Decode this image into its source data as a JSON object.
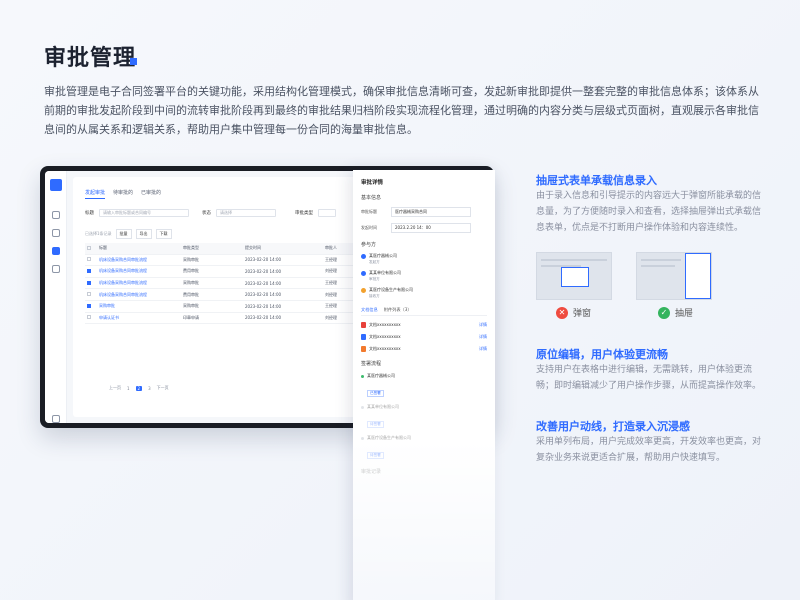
{
  "header": {
    "title": "审批管理",
    "description": "审批管理是电子合同签署平台的关键功能，采用结构化管理模式，确保审批信息清晰可查，发起新审批即提供一整套完整的审批信息体系；该体系从前期的审批发起阶段到中间的流转审批阶段再到最终的审批结果归档阶段实现流程化管理，通过明确的内容分类与层级式页面树，直观展示各审批信息间的从属关系和逻辑关系，帮助用户集中管理每一份合同的海量审批信息。"
  },
  "mockup": {
    "tabs": [
      "发起审批",
      "待审批的",
      "已审批的"
    ],
    "filter": {
      "label1": "标题",
      "placeholder1": "请输入审批标题或合同编号",
      "label2": "状态",
      "placeholder2": "请选择",
      "label3": "审批类型"
    },
    "toolbar": {
      "label": "已选择1条记录",
      "btn1": "批量",
      "btn2": "导出",
      "btn3": "下载"
    },
    "table": {
      "headers": [
        "标题",
        "审批类型",
        "提交时间",
        "审批人"
      ],
      "rows": [
        {
          "checked": false,
          "title": "机床设备采购合同审批流程",
          "type": "采购审批",
          "time": "2023-02-20 14:00",
          "owner": "王经理"
        },
        {
          "checked": true,
          "title": "机床设备采购合同审批流程",
          "type": "费用审批",
          "time": "2023-02-20 14:00",
          "owner": "刘经理"
        },
        {
          "checked": true,
          "title": "机床设备采购合同审批流程",
          "type": "采购审批",
          "time": "2023-02-20 14:00",
          "owner": "王经理"
        },
        {
          "checked": false,
          "title": "机床设备采购合同审批流程",
          "type": "费用审批",
          "time": "2023-02-20 14:00",
          "owner": "刘经理"
        },
        {
          "checked": true,
          "title": "采购审批",
          "type": "采购审批",
          "time": "2023-02-20 14:00",
          "owner": "王经理"
        },
        {
          "checked": false,
          "title": "申请认证书",
          "type": "印章申请",
          "time": "2023-02-20 14:00",
          "owner": "刘经理"
        }
      ]
    },
    "pager": [
      "上一页",
      "1",
      "2",
      "3",
      "下一页"
    ]
  },
  "drawer": {
    "title": "审批详情",
    "section_basic": "基本信息",
    "field1_label": "审批标题",
    "field1_value": "医疗器械采购合同",
    "field2_label": "发起时间",
    "field2_value": "2023.2.20 14：00",
    "section_party": "参与方",
    "parties": [
      {
        "name": "某医疗器械公司",
        "sub": "发起方"
      },
      {
        "name": "某某单位有限公司",
        "sub": "审批方"
      },
      {
        "name": "某医疗设备生产有限公司",
        "sub": "接收方"
      }
    ],
    "tab_files": "文档信息",
    "tab_attach": "附件列表（3）",
    "files": [
      {
        "name": "文档xxxxxxxxxx",
        "link": "详情"
      },
      {
        "name": "文档xxxxxxxxxx",
        "link": "详情"
      },
      {
        "name": "文档xxxxxxxxxx",
        "link": "详情"
      }
    ],
    "section_flow": "签署流程",
    "flow": [
      {
        "name": "某医疗器械公司",
        "tag": "已签署"
      },
      {
        "name": "某某单位有限公司",
        "tag": "待签署"
      },
      {
        "name": "某医疗设备生产有限公司",
        "tag": "待签署"
      }
    ],
    "section_record": "审批记录"
  },
  "features": [
    {
      "title": "抽屉式表单承载信息录入",
      "desc": "由于录入信息和引导提示的内容远大于弹窗所能承载的信息量，为了方便随时录入和查看，选择抽屉弹出式承载信息表单，优点是不打断用户操作体验和内容连续性。"
    },
    {
      "title": "原位编辑，用户体验更流畅",
      "desc": "支持用户在表格中进行编辑，无需跳转，用户体验更流畅；即时编辑减少了用户操作步骤，从而提高操作效率。"
    },
    {
      "title": "改善用户动线，打造录入沉浸感",
      "desc": "采用单列布局，用户完成效率更高，开发效率也更高，对复杂业务来说更适合扩展，帮助用户快速填写。"
    }
  ],
  "illustrations": {
    "popup_label": "弹窗",
    "drawer_label": "抽屉"
  }
}
